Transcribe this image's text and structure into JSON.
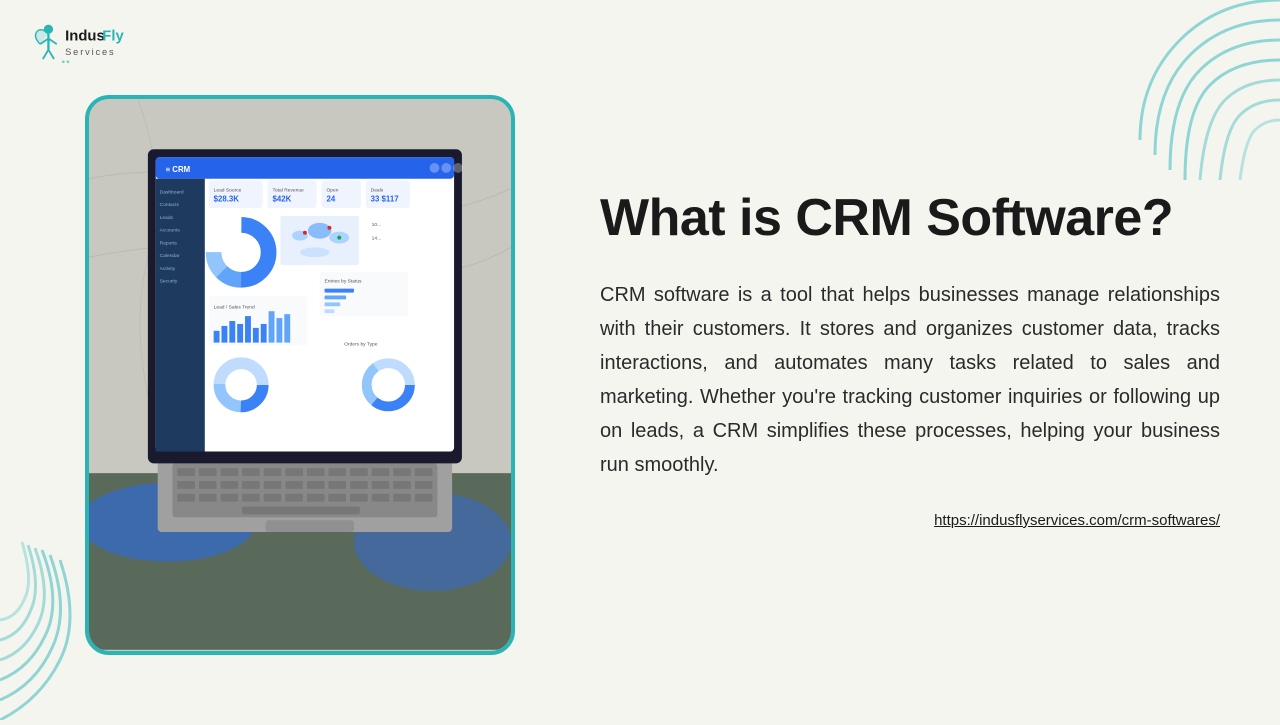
{
  "logo": {
    "company_name": "IndusFly",
    "subtitle": "Services"
  },
  "header": {
    "title": "What is CRM Software?"
  },
  "body": {
    "description": "CRM software is a tool that helps businesses manage relationships with their customers. It stores and organizes customer data, tracks interactions, and automates many tasks related to sales and marketing. Whether you're tracking customer inquiries or following up on leads, a CRM simplifies these processes, helping your business run smoothly."
  },
  "footer": {
    "link_text": "https://indusflyservices.com/crm-softwares/",
    "link_href": "https://indusflyservices.com/crm-softwares/"
  },
  "colors": {
    "teal": "#2ab5b5",
    "dark": "#1a1a1a",
    "bg": "#f5f5f0"
  }
}
